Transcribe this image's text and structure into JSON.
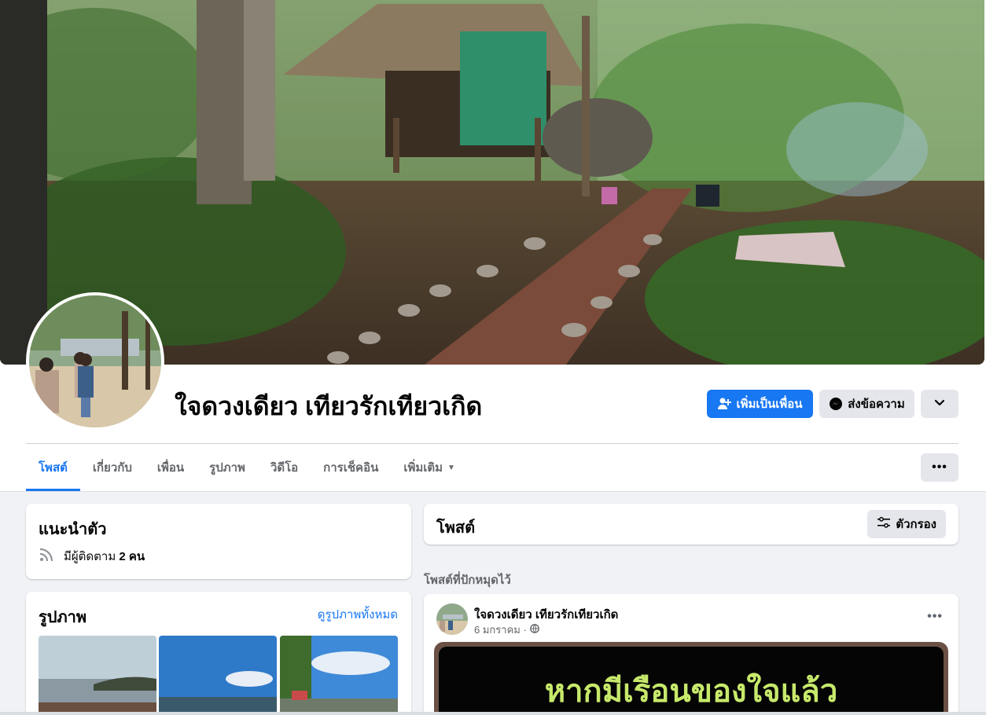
{
  "profile": {
    "name": "ใจดวงเดียว เทียวรักเทียวเกิด"
  },
  "actions": {
    "add_friend": "เพิ่มเป็นเพื่อน",
    "message": "ส่งข้อความ"
  },
  "tabs": [
    {
      "label": "โพสต์"
    },
    {
      "label": "เกี่ยวกับ"
    },
    {
      "label": "เพื่อน"
    },
    {
      "label": "รูปภาพ"
    },
    {
      "label": "วิดีโอ"
    },
    {
      "label": "การเช็คอิน"
    },
    {
      "label": "เพิ่มเติม"
    }
  ],
  "intro": {
    "title": "แนะนำตัว",
    "followers_prefix": "มีผู้ติดตาม ",
    "followers_count": "2 คน"
  },
  "photos": {
    "title": "รูปภาพ",
    "see_all": "ดูรูปภาพทั้งหมด"
  },
  "posts": {
    "title": "โพสต์",
    "filter": "ตัวกรอง",
    "pinned_label": "โพสต์ที่ปักหมุดไว้"
  },
  "pinned_post": {
    "author": "ใจดวงเดียว เทียวรักเทียวเกิด",
    "date": "6 มกราคม ·",
    "image_text": "หากมีเรือนของใจแล้ว"
  },
  "colors": {
    "accent": "#1877f2",
    "page_bg": "#f0f2f5",
    "secondary_text": "#65676b"
  }
}
